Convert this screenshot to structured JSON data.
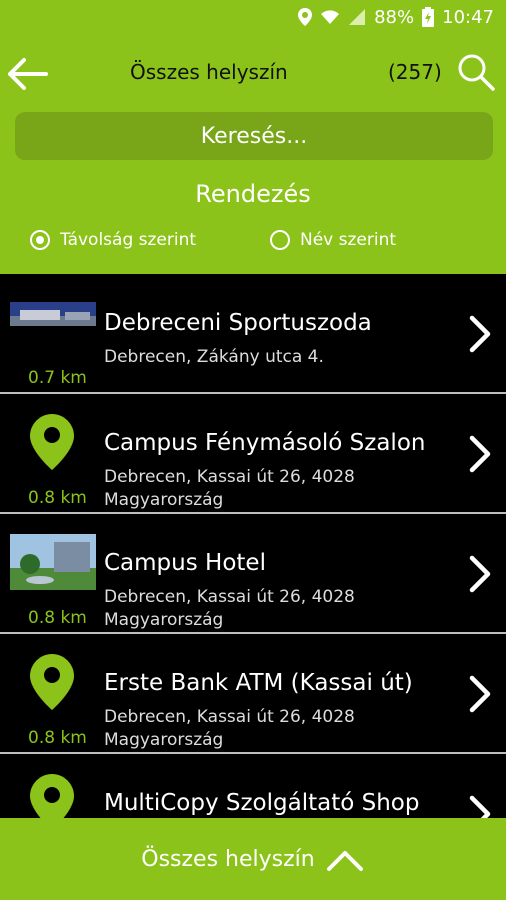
{
  "status_bar": {
    "battery": "88%",
    "time": "10:47"
  },
  "header": {
    "title": "Összes helyszín",
    "count": "(257)"
  },
  "search": {
    "label": "Keresés..."
  },
  "sort": {
    "title": "Rendezés",
    "options": [
      {
        "label": "Távolság szerint",
        "selected": true
      },
      {
        "label": "Név szerint",
        "selected": false
      }
    ]
  },
  "items": [
    {
      "name": "Debreceni Sportuszoda",
      "address": "Debrecen, Zákány utca 4.",
      "distance": "0.7 km",
      "icon": "photo-thumbnail"
    },
    {
      "name": "Campus Fénymásoló Szalon",
      "address": "Debrecen, Kassai út 26, 4028 Magyarország",
      "distance": "0.8 km",
      "icon": "map-pin-icon"
    },
    {
      "name": "Campus Hotel",
      "address": "Debrecen, Kassai út 26, 4028 Magyarország",
      "distance": "0.8 km",
      "icon": "photo-thumbnail"
    },
    {
      "name": "Erste Bank ATM (Kassai út)",
      "address": "Debrecen, Kassai út 26, 4028 Magyarország",
      "distance": "0.8 km",
      "icon": "map-pin-icon"
    },
    {
      "name": "MultiCopy Szolgáltató Shop",
      "address": "",
      "distance": "",
      "icon": "map-pin-icon"
    }
  ],
  "bottom_bar": {
    "label": "Összes helyszín"
  },
  "colors": {
    "accent": "#8cc31b",
    "search_bg": "#78a618",
    "background": "#000000"
  }
}
